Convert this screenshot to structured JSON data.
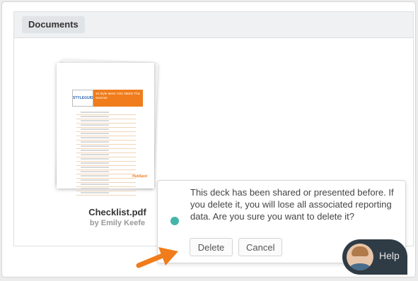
{
  "panel": {
    "tab_label": "Documents"
  },
  "document": {
    "title": "Checklist.pdf",
    "author": "by Emily Keefe",
    "thumbnail": {
      "logo_text": "STYLEGUIDE",
      "banner_text": "10 Style Items YOU NEED This Summer",
      "footer_text": "HubSpot"
    }
  },
  "popover": {
    "message": "This deck has been shared or presented before. If you delete it, you will lose all associated reporting data. Are you sure you want to delete it?",
    "delete_label": "Delete",
    "cancel_label": "Cancel",
    "dot_color": "#45b5aa"
  },
  "help": {
    "label": "Help"
  },
  "colors": {
    "arrow": "#f07c1b",
    "accent": "#45b5aa"
  }
}
